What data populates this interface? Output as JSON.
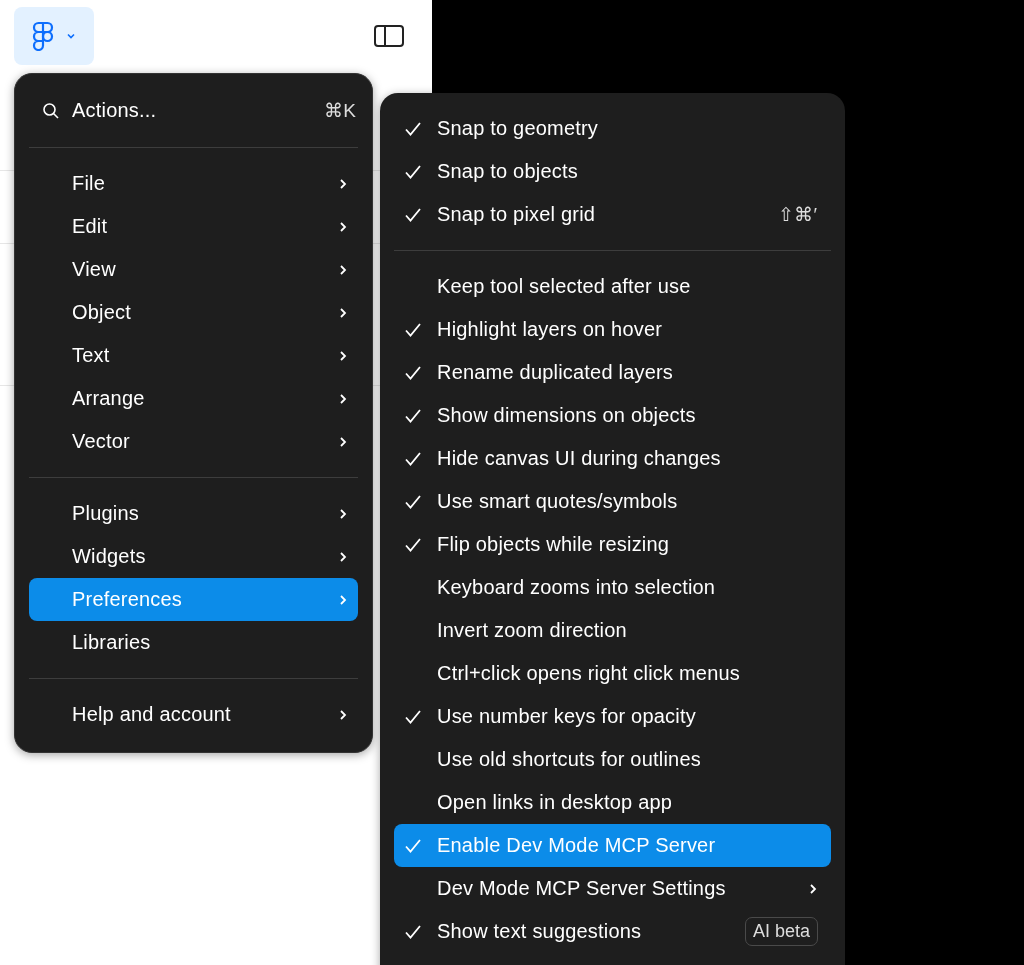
{
  "toolbar": {
    "logo_menu_open": true
  },
  "main_menu": {
    "search": {
      "label": "Actions...",
      "shortcut": "⌘K"
    },
    "groups": [
      [
        {
          "label": "File",
          "submenu": true,
          "selected": false
        },
        {
          "label": "Edit",
          "submenu": true,
          "selected": false
        },
        {
          "label": "View",
          "submenu": true,
          "selected": false
        },
        {
          "label": "Object",
          "submenu": true,
          "selected": false
        },
        {
          "label": "Text",
          "submenu": true,
          "selected": false
        },
        {
          "label": "Arrange",
          "submenu": true,
          "selected": false
        },
        {
          "label": "Vector",
          "submenu": true,
          "selected": false
        }
      ],
      [
        {
          "label": "Plugins",
          "submenu": true,
          "selected": false
        },
        {
          "label": "Widgets",
          "submenu": true,
          "selected": false
        },
        {
          "label": "Preferences",
          "submenu": true,
          "selected": true
        },
        {
          "label": "Libraries",
          "submenu": false,
          "selected": false
        }
      ],
      [
        {
          "label": "Help and account",
          "submenu": true,
          "selected": false
        }
      ]
    ]
  },
  "preferences_menu": {
    "groups": [
      [
        {
          "label": "Snap to geometry",
          "checked": true,
          "selected": false
        },
        {
          "label": "Snap to objects",
          "checked": true,
          "selected": false
        },
        {
          "label": "Snap to pixel grid",
          "checked": true,
          "selected": false,
          "shortcut": "⇧⌘′"
        }
      ],
      [
        {
          "label": "Keep tool selected after use",
          "checked": false,
          "selected": false
        },
        {
          "label": "Highlight layers on hover",
          "checked": true,
          "selected": false
        },
        {
          "label": "Rename duplicated layers",
          "checked": true,
          "selected": false
        },
        {
          "label": "Show dimensions on objects",
          "checked": true,
          "selected": false
        },
        {
          "label": "Hide canvas UI during changes",
          "checked": true,
          "selected": false
        },
        {
          "label": "Use smart quotes/symbols",
          "checked": true,
          "selected": false
        },
        {
          "label": "Flip objects while resizing",
          "checked": true,
          "selected": false
        },
        {
          "label": "Keyboard zooms into selection",
          "checked": false,
          "selected": false
        },
        {
          "label": "Invert zoom direction",
          "checked": false,
          "selected": false
        },
        {
          "label": "Ctrl+click opens right click menus",
          "checked": false,
          "selected": false
        },
        {
          "label": "Use number keys for opacity",
          "checked": true,
          "selected": false
        },
        {
          "label": "Use old shortcuts for outlines",
          "checked": false,
          "selected": false
        },
        {
          "label": "Open links in desktop app",
          "checked": false,
          "selected": false
        },
        {
          "label": "Enable Dev Mode MCP Server",
          "checked": true,
          "selected": true
        },
        {
          "label": "Dev Mode MCP Server Settings",
          "checked": false,
          "selected": false,
          "submenu": true
        },
        {
          "label": "Show text suggestions",
          "checked": true,
          "selected": false,
          "badge": "AI beta"
        }
      ]
    ]
  }
}
